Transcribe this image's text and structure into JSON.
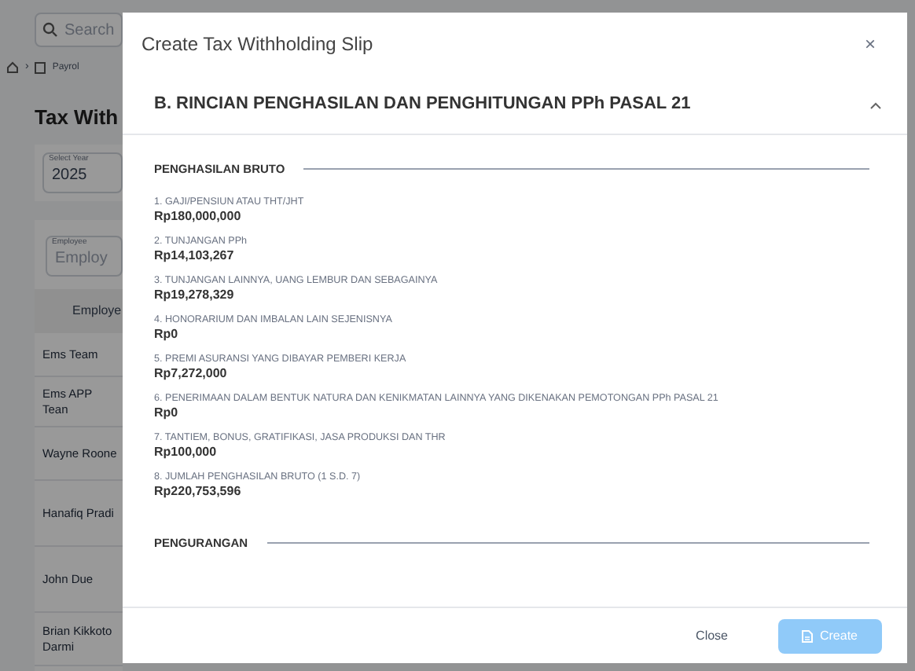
{
  "background": {
    "search": {
      "placeholder": "Search"
    },
    "breadcrumb_separator": "›",
    "breadcrumb": "Payrol",
    "title": "Tax With",
    "year": {
      "label": "Select Year",
      "value": "2025"
    },
    "employee_filter": {
      "label": "Employee",
      "placeholder": "Employ"
    },
    "table": {
      "columns": [
        "Employe"
      ],
      "rows": [
        "Ems Team",
        "Ems APP Tean",
        "Wayne Roone",
        "Hanafiq Pradi",
        "John Due",
        "Brian Kikkoto Darmi"
      ]
    }
  },
  "modal": {
    "title": "Create Tax Withholding Slip",
    "close": "×",
    "section": {
      "title": "B. RINCIAN PENGHASILAN DAN PENGHITUNGAN PPh PASAL 21",
      "expanded": true,
      "groups": [
        {
          "title": "PENGHASILAN BRUTO",
          "items": [
            {
              "label": "1. GAJI/PENSIUN ATAU THT/JHT",
              "value": "Rp180,000,000"
            },
            {
              "label": "2. TUNJANGAN PPh",
              "value": "Rp14,103,267"
            },
            {
              "label": "3. TUNJANGAN LAINNYA, UANG LEMBUR DAN SEBAGAINYA",
              "value": "Rp19,278,329"
            },
            {
              "label": "4. HONORARIUM DAN IMBALAN LAIN SEJENISNYA",
              "value": "Rp0"
            },
            {
              "label": "5. PREMI ASURANSI YANG DIBAYAR PEMBERI KERJA",
              "value": "Rp7,272,000"
            },
            {
              "label": "6. PENERIMAAN DALAM BENTUK NATURA DAN KENIKMATAN LAINNYA YANG DIKENAKAN PEMOTONGAN PPh PASAL 21",
              "value": "Rp0"
            },
            {
              "label": "7. TANTIEM, BONUS, GRATIFIKASI, JASA PRODUKSI DAN THR",
              "value": "Rp100,000"
            },
            {
              "label": "8. JUMLAH PENGHASILAN BRUTO (1 S.D. 7)",
              "value": "Rp220,753,596"
            }
          ]
        },
        {
          "title": "PENGURANGAN"
        }
      ]
    },
    "buttons": [
      {
        "label": "Close",
        "kind": "text",
        "disabled": false
      },
      {
        "label": "Create",
        "kind": "primary",
        "disabled": true
      }
    ]
  }
}
